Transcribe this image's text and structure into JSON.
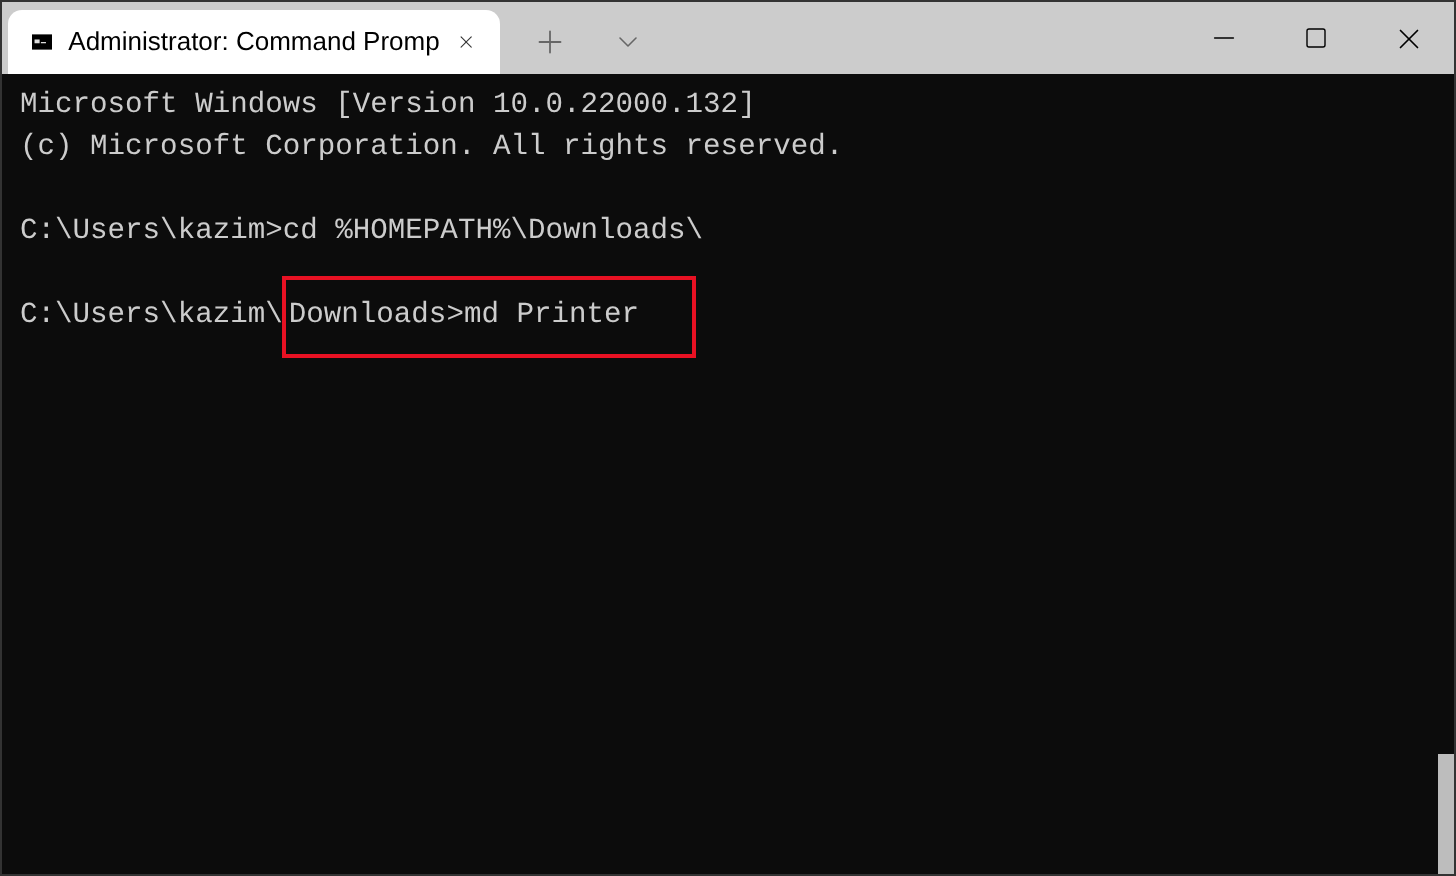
{
  "tab": {
    "title": "Administrator: Command Promp",
    "selected": true
  },
  "terminal": {
    "blocks": [
      {
        "lines": [
          {
            "text": "Microsoft Windows [Version 10.0.22000.132]"
          },
          {
            "text": "(c) Microsoft Corporation. All rights reserved."
          }
        ]
      },
      {
        "lines": [
          {
            "text": "C:\\Users\\kazim>cd %HOMEPATH%\\Downloads\\"
          }
        ]
      },
      {
        "lines": [
          {
            "text": "C:\\Users\\kazim\\",
            "highlight": "Downloads>md Printer"
          }
        ]
      }
    ]
  }
}
